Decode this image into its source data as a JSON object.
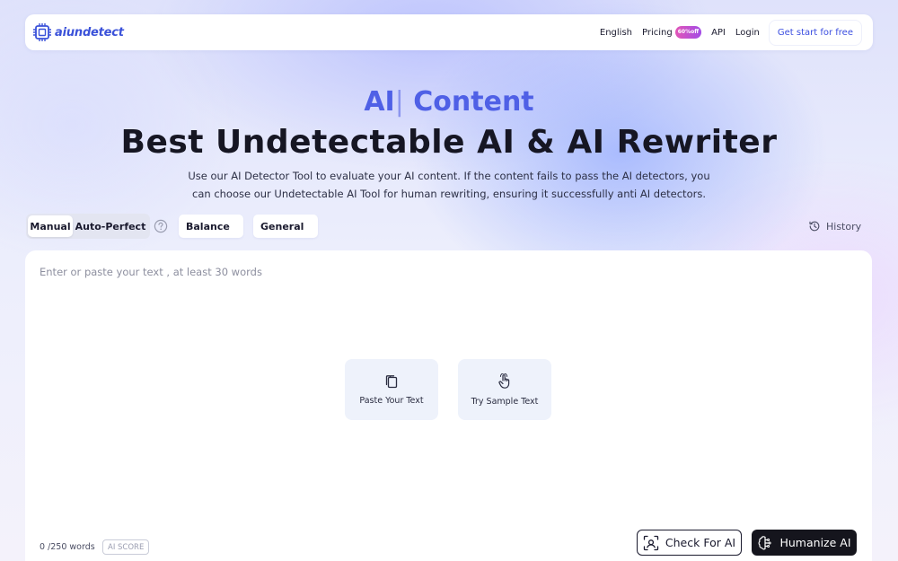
{
  "brand": {
    "name": "aiundetect",
    "color": "#3b52d9"
  },
  "nav": {
    "language": "English",
    "pricing": "Pricing",
    "pricing_badge": "60%off",
    "api": "API",
    "login": "Login",
    "cta": "Get start for free"
  },
  "hero": {
    "subtitle": "AI",
    "subtitle_cursor": "|",
    "subtitle_rest": " Content",
    "title": "Best Undetectable AI & AI Rewriter",
    "description": "Use our AI Detector Tool to evaluate your AI content. If the content fails to pass the AI detectors, you can choose our Undetectable AI Tool for human rewriting, ensuring it successfully anti AI detectors."
  },
  "controls": {
    "modes": [
      "Manual",
      "Auto-Perfect"
    ],
    "active_mode": "Manual",
    "strength": "Balance",
    "purpose": "General",
    "history": "History"
  },
  "editor": {
    "placeholder": "Enter or paste your text , at least 30 words",
    "paste_label": "Paste Your Text",
    "sample_label": "Try Sample Text",
    "word_count": "0 /250 words",
    "ai_score": "AI SCORE",
    "check_label": "Check For AI",
    "humanize_label": "Humanize AI"
  },
  "icons": {
    "logo": "logo-chip-icon",
    "help": "question-circle-icon",
    "dropdown": "chevron-down-icon",
    "history": "history-clock-icon",
    "paste": "clipboard-icon",
    "sample": "pointer-hand-icon",
    "check": "scan-icon",
    "humanize": "brain-icon"
  },
  "colors": {
    "accent": "#4f60e6",
    "badge_start": "#e255b7",
    "badge_end": "#a24be6",
    "primary_button": "#15151d"
  }
}
